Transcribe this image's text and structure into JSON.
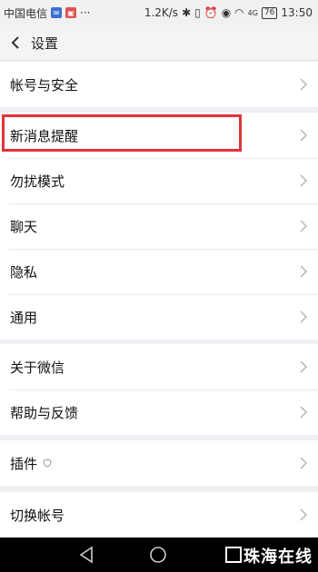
{
  "status_bar": {
    "carrier": "中国电信",
    "overflow": "···",
    "net_speed": "1.2K/s",
    "signal": "4G",
    "battery": "76",
    "time": "13:50"
  },
  "header": {
    "title": "设置"
  },
  "groups": [
    {
      "items": [
        {
          "label": "帐号与安全"
        }
      ]
    },
    {
      "items": [
        {
          "label": "新消息提醒"
        },
        {
          "label": "勿扰模式"
        },
        {
          "label": "聊天"
        },
        {
          "label": "隐私"
        },
        {
          "label": "通用"
        }
      ]
    },
    {
      "items": [
        {
          "label": "关于微信"
        },
        {
          "label": "帮助与反馈"
        }
      ]
    },
    {
      "items": [
        {
          "label": "插件"
        }
      ]
    },
    {
      "items": [
        {
          "label": "切换帐号"
        }
      ]
    }
  ],
  "watermark": "珠海在线",
  "colors": {
    "highlight": "#e1323a",
    "background": "#efeff4"
  }
}
